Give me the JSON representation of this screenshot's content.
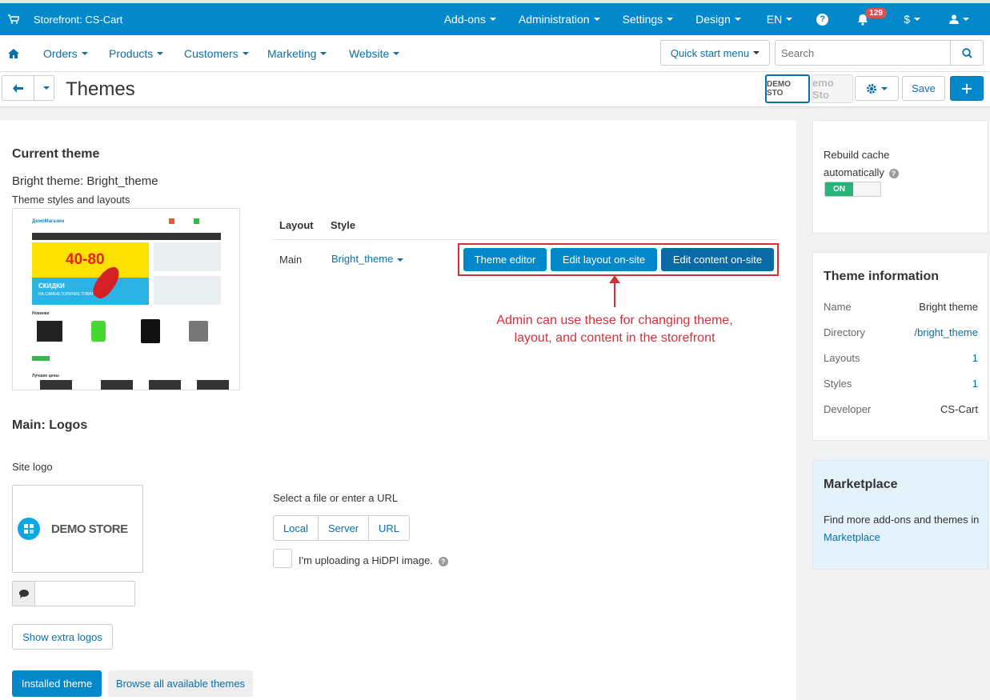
{
  "topbar": {
    "storefront_label": "Storefront: CS-Cart",
    "menu": [
      "Add-ons",
      "Administration",
      "Settings",
      "Design",
      "EN"
    ],
    "notifications_count": "129",
    "currency": "$",
    "bg_color": "#0388cc"
  },
  "navbar": {
    "items": [
      "Orders",
      "Products",
      "Customers",
      "Marketing",
      "Website"
    ],
    "quick_start": "Quick start menu",
    "search_placeholder": "Search"
  },
  "titlebar": {
    "title": "Themes",
    "demo_label_1": "DEMO STO",
    "demo_label_2": "emo Sto",
    "save_label": "Save"
  },
  "current_theme": {
    "heading": "Current theme",
    "theme_name": "Bright theme: Bright_theme",
    "styles_label": "Theme styles and layouts",
    "col_layout": "Layout",
    "col_style": "Style",
    "layout_value": "Main",
    "style_value": "Bright_theme",
    "btn_theme_editor": "Theme editor",
    "btn_edit_layout": "Edit layout on-site",
    "btn_edit_content": "Edit content on-site",
    "annotation": "Admin can use these for changing theme, layout, and content in the storefront"
  },
  "preview": {
    "logo_text": "ДемоМагазин",
    "promo": "40-80",
    "promo_sub": "СКИДКИ",
    "promo_sub2": "НА САМЫЕ ГОРЯЧИЕ ТОВАРЫ",
    "new_label": "Новинки",
    "best_label": "Лучшие цены"
  },
  "logos": {
    "heading": "Main: Logos",
    "site_logo_label": "Site logo",
    "logo_text": "DEMO STORE",
    "file_label": "Select a file or enter a URL",
    "sources": [
      "Local",
      "Server",
      "URL"
    ],
    "hidpi_label": "I'm uploading a HiDPI image.",
    "extra_logos": "Show extra logos"
  },
  "bottom_tabs": {
    "installed": "Installed theme",
    "browse": "Browse all available themes"
  },
  "sidebar": {
    "rebuild_line1": "Rebuild cache",
    "rebuild_line2": "automatically",
    "toggle_label": "ON",
    "info_title": "Theme information",
    "info": [
      {
        "k": "Name",
        "v": "Bright theme"
      },
      {
        "k": "Directory",
        "v": "/bright_theme"
      },
      {
        "k": "Layouts",
        "v": "1"
      },
      {
        "k": "Styles",
        "v": "1"
      },
      {
        "k": "Developer",
        "v": "CS-Cart"
      }
    ],
    "market_title": "Marketplace",
    "market_text": "Find more add-ons and themes in",
    "market_link": "Marketplace"
  }
}
